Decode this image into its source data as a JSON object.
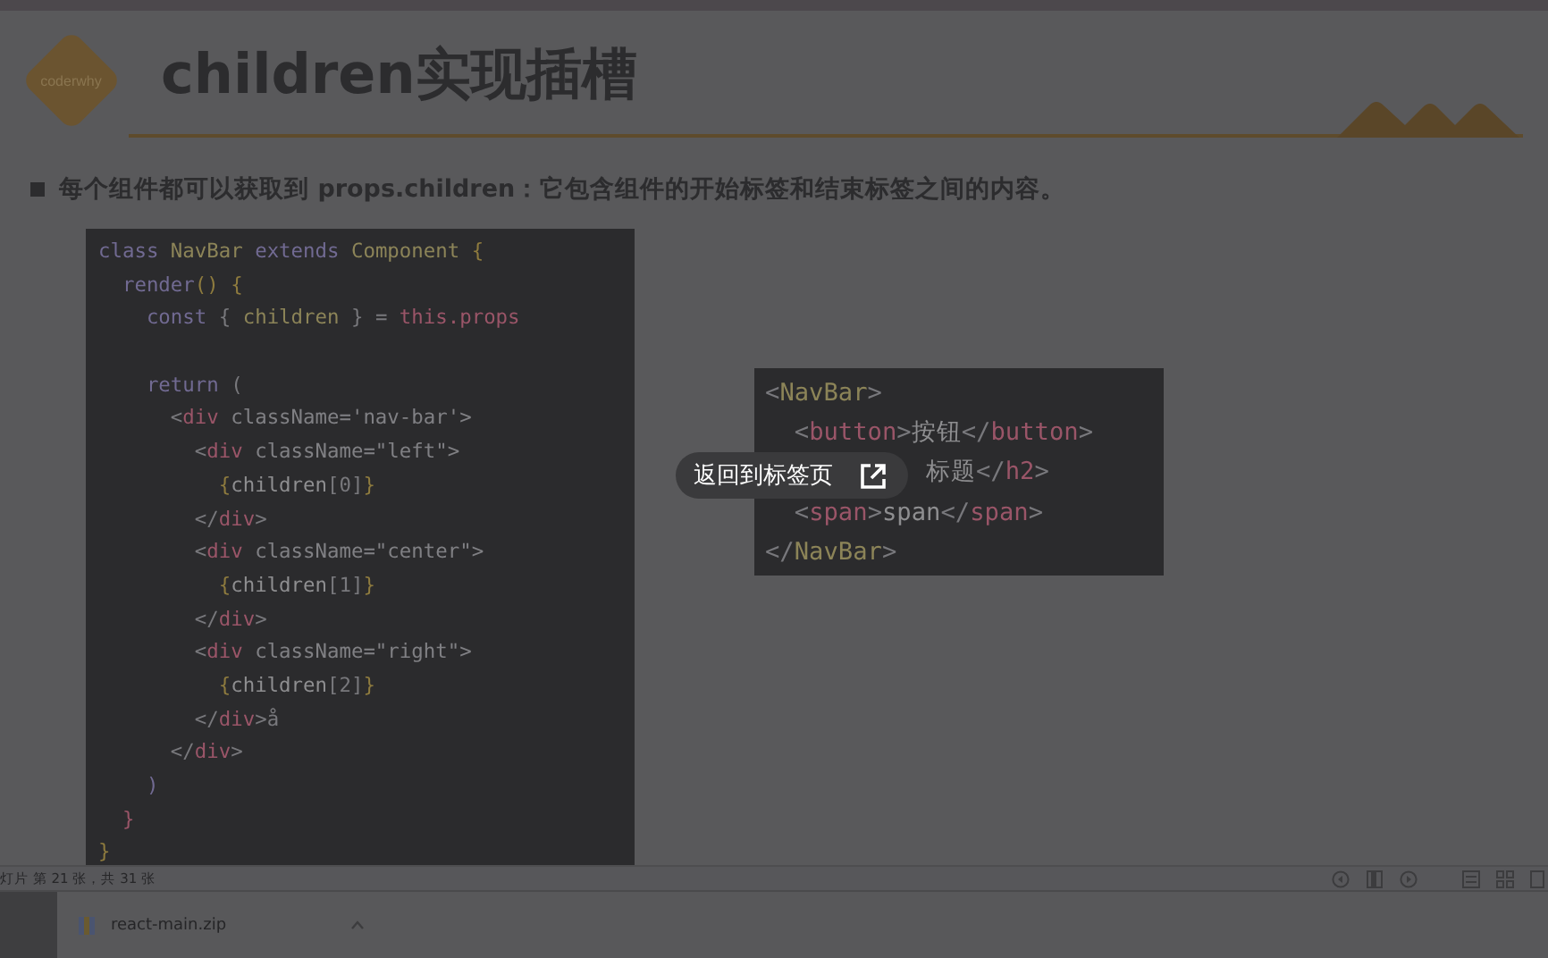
{
  "slide": {
    "logo_text": "coderwhy",
    "title": "children实现插槽",
    "bullet": "每个组件都可以获取到 props.children：它包含组件的开始标签和结束标签之间的内容。",
    "code_left": [
      {
        "blank_before": false,
        "tokens": [
          {
            "t": "class ",
            "kind": "kw"
          },
          {
            "t": "NavBar ",
            "kind": "type"
          },
          {
            "t": "extends ",
            "kind": "kw"
          },
          {
            "t": "Component ",
            "kind": "type"
          },
          {
            "t": "{",
            "kind": "brace"
          }
        ]
      },
      {
        "blank_before": false,
        "tokens": [
          {
            "t": "  render",
            "kind": "kw"
          },
          {
            "t": "() {",
            "kind": "brace"
          }
        ]
      },
      {
        "blank_before": false,
        "tokens": [
          {
            "t": "    const ",
            "kind": "kw"
          },
          {
            "t": "{ ",
            "kind": "punc"
          },
          {
            "t": "children ",
            "kind": "type"
          },
          {
            "t": "} = ",
            "kind": "punc"
          },
          {
            "t": "this.props",
            "kind": "tag"
          }
        ]
      },
      {
        "blank_before": true,
        "tokens": [
          {
            "t": "    return ",
            "kind": "kw"
          },
          {
            "t": "(",
            "kind": "punc"
          }
        ]
      },
      {
        "blank_before": false,
        "tokens": [
          {
            "t": "      <",
            "kind": "punc"
          },
          {
            "t": "div ",
            "kind": "tag"
          },
          {
            "t": "className='nav-bar'>",
            "kind": "str"
          }
        ]
      },
      {
        "blank_before": false,
        "tokens": [
          {
            "t": "        <",
            "kind": "punc"
          },
          {
            "t": "div ",
            "kind": "tag"
          },
          {
            "t": "className=\"left\">",
            "kind": "str"
          }
        ]
      },
      {
        "blank_before": false,
        "tokens": [
          {
            "t": "          {",
            "kind": "brace"
          },
          {
            "t": "children",
            "kind": "plain"
          },
          {
            "t": "[0]",
            "kind": "punc"
          },
          {
            "t": "}",
            "kind": "brace"
          }
        ]
      },
      {
        "blank_before": false,
        "tokens": [
          {
            "t": "        </",
            "kind": "punc"
          },
          {
            "t": "div",
            "kind": "tag"
          },
          {
            "t": ">",
            "kind": "punc"
          }
        ]
      },
      {
        "blank_before": false,
        "tokens": [
          {
            "t": "        <",
            "kind": "punc"
          },
          {
            "t": "div ",
            "kind": "tag"
          },
          {
            "t": "className=\"center\">",
            "kind": "str"
          }
        ]
      },
      {
        "blank_before": false,
        "tokens": [
          {
            "t": "          {",
            "kind": "brace"
          },
          {
            "t": "children",
            "kind": "plain"
          },
          {
            "t": "[1]",
            "kind": "punc"
          },
          {
            "t": "}",
            "kind": "brace"
          }
        ]
      },
      {
        "blank_before": false,
        "tokens": [
          {
            "t": "        </",
            "kind": "punc"
          },
          {
            "t": "div",
            "kind": "tag"
          },
          {
            "t": ">",
            "kind": "punc"
          }
        ]
      },
      {
        "blank_before": false,
        "tokens": [
          {
            "t": "        <",
            "kind": "punc"
          },
          {
            "t": "div ",
            "kind": "tag"
          },
          {
            "t": "className=\"right\">",
            "kind": "str"
          }
        ]
      },
      {
        "blank_before": false,
        "tokens": [
          {
            "t": "          {",
            "kind": "brace"
          },
          {
            "t": "children",
            "kind": "plain"
          },
          {
            "t": "[2]",
            "kind": "punc"
          },
          {
            "t": "}",
            "kind": "brace"
          }
        ]
      },
      {
        "blank_before": false,
        "tokens": [
          {
            "t": "        </",
            "kind": "punc"
          },
          {
            "t": "div",
            "kind": "tag"
          },
          {
            "t": ">å",
            "kind": "punc"
          }
        ]
      },
      {
        "blank_before": false,
        "tokens": [
          {
            "t": "      </",
            "kind": "punc"
          },
          {
            "t": "div",
            "kind": "tag"
          },
          {
            "t": ">",
            "kind": "punc"
          }
        ]
      },
      {
        "blank_before": false,
        "tokens": [
          {
            "t": "    )",
            "kind": "kw"
          }
        ]
      },
      {
        "blank_before": false,
        "tokens": [
          {
            "t": "  }",
            "kind": "tag"
          }
        ]
      },
      {
        "blank_before": false,
        "tokens": [
          {
            "t": "}",
            "kind": "brace"
          }
        ]
      }
    ],
    "code_right": [
      {
        "covered": false,
        "tokens": [
          {
            "t": "<",
            "kind": "punc"
          },
          {
            "t": "NavBar",
            "kind": "type"
          },
          {
            "t": ">",
            "kind": "punc"
          }
        ]
      },
      {
        "covered": false,
        "tokens": [
          {
            "t": "  <",
            "kind": "punc"
          },
          {
            "t": "button",
            "kind": "tag"
          },
          {
            "t": ">",
            "kind": "punc"
          },
          {
            "t": "按钮",
            "kind": "plain"
          },
          {
            "t": "</",
            "kind": "punc"
          },
          {
            "t": "button",
            "kind": "tag"
          },
          {
            "t": ">",
            "kind": "punc"
          }
        ]
      },
      {
        "covered": true,
        "tokens": [
          {
            "t": "标题",
            "kind": "plain"
          },
          {
            "t": "</",
            "kind": "punc"
          },
          {
            "t": "h2",
            "kind": "tag"
          },
          {
            "t": ">",
            "kind": "punc"
          }
        ]
      },
      {
        "covered": false,
        "tokens": [
          {
            "t": "  <",
            "kind": "punc"
          },
          {
            "t": "span",
            "kind": "tag"
          },
          {
            "t": ">",
            "kind": "punc"
          },
          {
            "t": "span",
            "kind": "plain"
          },
          {
            "t": "</",
            "kind": "punc"
          },
          {
            "t": "span",
            "kind": "tag"
          },
          {
            "t": ">",
            "kind": "punc"
          }
        ]
      },
      {
        "covered": false,
        "tokens": [
          {
            "t": "</",
            "kind": "punc"
          },
          {
            "t": "NavBar",
            "kind": "type"
          },
          {
            "t": ">",
            "kind": "punc"
          }
        ]
      }
    ]
  },
  "tooltip": {
    "label": "返回到标签页"
  },
  "status_bar": {
    "slide_count": "灯片 第 21 张，共 31 张"
  },
  "download_bar": {
    "file_name": "react-main.zip"
  }
}
